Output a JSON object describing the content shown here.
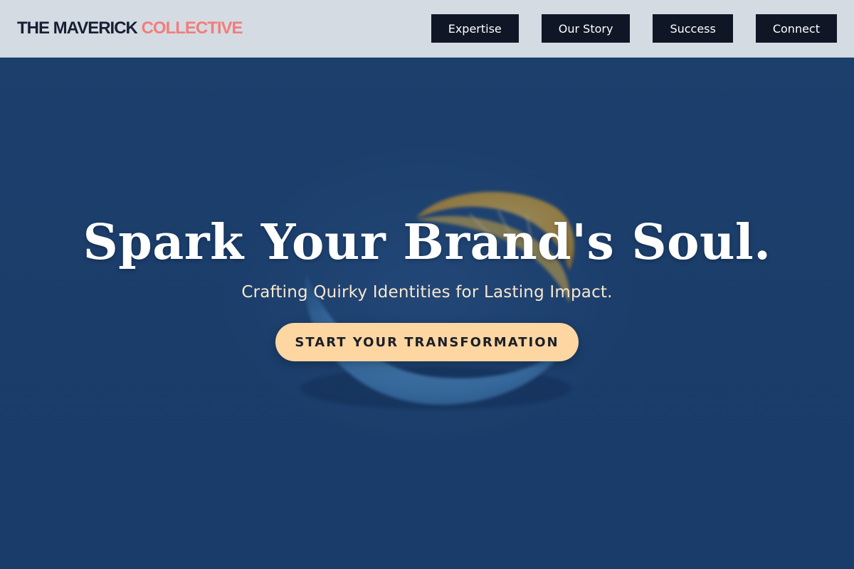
{
  "header": {
    "logo_primary": "THE MAVERICK",
    "logo_accent": "COLLECTIVE",
    "nav": [
      {
        "label": "Expertise"
      },
      {
        "label": "Our Story"
      },
      {
        "label": "Success"
      },
      {
        "label": "Connect"
      }
    ]
  },
  "hero": {
    "headline": "Spark Your Brand's Soul.",
    "tagline": "Crafting Quirky Identities for Lasting Impact.",
    "cta_label": "START YOUR TRANSFORMATION",
    "image_description_icon": "lemon-slice-image"
  },
  "colors": {
    "nav_bg": "#d5dbe3",
    "nav_button": "#0f1726",
    "logo_accent": "#f07e7b",
    "hero_bg": "#1d3f6b",
    "cta_bg": "#fdd6a2"
  }
}
